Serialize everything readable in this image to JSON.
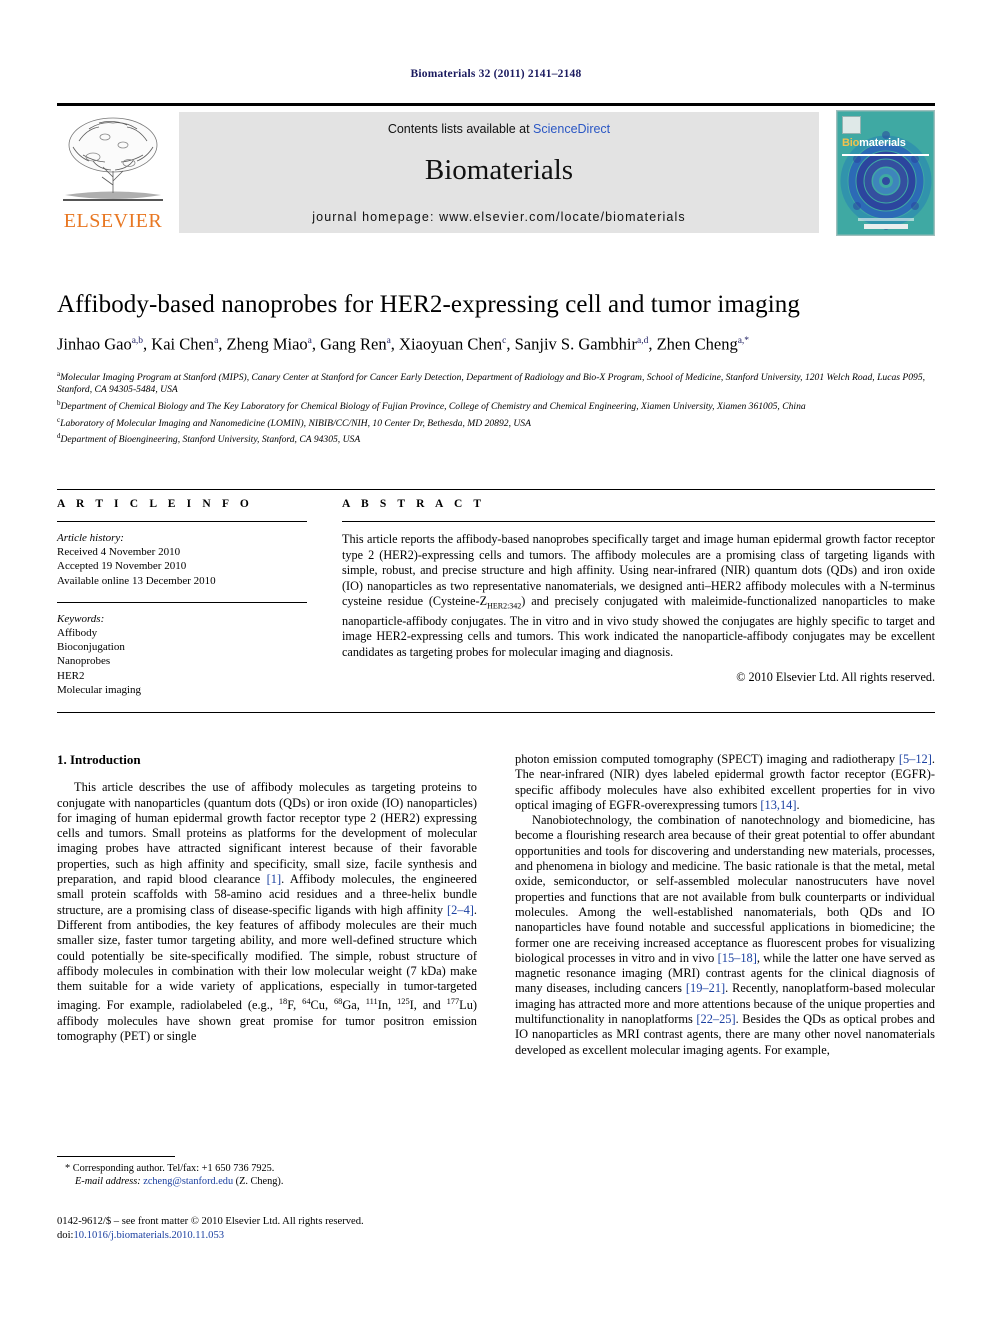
{
  "running_head": "Biomaterials 32 (2011) 2141–2148",
  "masthead": {
    "contents_prefix": "Contents lists available at ",
    "sciencedirect": "ScienceDirect",
    "journal_name": "Biomaterials",
    "homepage": "journal homepage: www.elsevier.com/locate/biomaterials",
    "publisher_wordmark": "ELSEVIER",
    "cover_title_bio": "Bio",
    "cover_title_rest": "materials",
    "colors": {
      "elsevier_orange": "#E87722",
      "link_blue": "#2b57c4",
      "cover_teal": "#3aa9a5",
      "cover_blue": "#2f3f9e"
    }
  },
  "article": {
    "title": "Affibody-based nanoprobes for HER2-expressing cell and tumor imaging",
    "authors": [
      {
        "name": "Jinhao Gao",
        "marks": "a,b"
      },
      {
        "name": "Kai Chen",
        "marks": "a"
      },
      {
        "name": "Zheng Miao",
        "marks": "a"
      },
      {
        "name": "Gang Ren",
        "marks": "a"
      },
      {
        "name": "Xiaoyuan Chen",
        "marks": "c"
      },
      {
        "name": "Sanjiv S. Gambhir",
        "marks": "a,d"
      },
      {
        "name": "Zhen Cheng",
        "marks": "a,*"
      }
    ],
    "affiliations": [
      {
        "mark": "a",
        "text": "Molecular Imaging Program at Stanford (MIPS), Canary Center at Stanford for Cancer Early Detection, Department of Radiology and Bio-X Program, School of Medicine, Stanford University, 1201 Welch Road, Lucas P095, Stanford, CA 94305-5484, USA"
      },
      {
        "mark": "b",
        "text": "Department of Chemical Biology and The Key Laboratory for Chemical Biology of Fujian Province, College of Chemistry and Chemical Engineering, Xiamen University, Xiamen 361005, China"
      },
      {
        "mark": "c",
        "text": "Laboratory of Molecular Imaging and Nanomedicine (LOMIN), NIBIB/CC/NIH, 10 Center Dr, Bethesda, MD 20892, USA"
      },
      {
        "mark": "d",
        "text": "Department of Bioengineering, Stanford University, Stanford, CA 94305, USA"
      }
    ]
  },
  "article_info": {
    "heading": "A R T I C L E   I N F O",
    "history_label": "Article history:",
    "history": [
      "Received 4 November 2010",
      "Accepted 19 November 2010",
      "Available online 13 December 2010"
    ],
    "keywords_label": "Keywords:",
    "keywords": [
      "Affibody",
      "Bioconjugation",
      "Nanoprobes",
      "HER2",
      "Molecular imaging"
    ]
  },
  "abstract": {
    "heading": "A B S T R A C T",
    "part1": "This article reports the affibody-based nanoprobes specifically target and image human epidermal growth factor receptor type 2 (HER2)-expressing cells and tumors. The affibody molecules are a promising class of targeting ligands with simple, robust, and precise structure and high affinity. Using near-infrared (NIR) quantum dots (QDs) and iron oxide (IO) nanoparticles as two representative nanomaterials, we designed anti–HER2 affibody molecules with a N-terminus cysteine residue (Cysteine-Z",
    "subscript": "HER2:342",
    "part2": ") and precisely conjugated with maleimide-functionalized nanoparticles to make nanoparticle-affibody conjugates. The in vitro and in vivo study showed the conjugates are highly specific to target and image HER2-expressing cells and tumors. This work indicated the nanoparticle-affibody conjugates may be excellent candidates as targeting probes for molecular imaging and diagnosis.",
    "copyright": "© 2010 Elsevier Ltd. All rights reserved."
  },
  "body": {
    "section_title": "1.  Introduction",
    "left_p1_a": "This article describes the use of affibody molecules as targeting proteins to conjugate with nanoparticles (quantum dots (QDs) or iron oxide (IO) nanoparticles) for imaging of human epidermal growth factor receptor type 2 (HER2) expressing cells and tumors. Small proteins as platforms for the development of molecular imaging probes have attracted significant interest because of their favorable properties, such as high affinity and specificity, small size, facile synthesis and preparation, and rapid blood clearance ",
    "left_ref1": "[1]",
    "left_p1_b": ". Affibody molecules, the engineered small protein scaffolds with 58-amino acid residues and a three-helix bundle structure, are a promising class of disease-specific ligands with high affinity ",
    "left_ref2": "[2–4]",
    "left_p1_c": ". Different from antibodies, the key features of affibody molecules are their much smaller size, faster tumor targeting ability, and more well-defined structure which could potentially be site-specifically modified. The simple, robust structure of affibody molecules in combination with their low molecular weight (7 kDa) make them suitable for a wide variety of applications, especially in tumor-targeted imaging. For example, radiolabeled (e.g., ",
    "iso_18": "18",
    "iso_18_el": "F, ",
    "iso_64": "64",
    "iso_64_el": "Cu, ",
    "iso_68": "68",
    "iso_68_el": "Ga, ",
    "iso_111": "111",
    "iso_111_el": "In, ",
    "iso_125": "125",
    "iso_125_el": "I, and ",
    "iso_177": "177",
    "iso_177_el": "Lu) affibody molecules have shown great promise for tumor positron emission tomography (PET) or single",
    "right_p1_a": "photon emission computed tomography (SPECT) imaging and radiotherapy ",
    "right_ref1": "[5–12]",
    "right_p1_b": ". The near-infrared (NIR) dyes labeled epidermal growth factor receptor (EGFR)-specific affibody molecules have also exhibited excellent properties for in vivo optical imaging of EGFR-overexpressing tumors ",
    "right_ref2": "[13,14]",
    "right_p1_c": ".",
    "right_p2_a": "Nanobiotechnology, the combination of nanotechnology and biomedicine, has become a flourishing research area because of their great potential to offer abundant opportunities and tools for discovering and understanding new materials, processes, and phenomena in biology and medicine. The basic rationale is that the metal, metal oxide, semiconductor, or self-assembled molecular nanostrucuters have novel properties and functions that are not available from bulk counterparts or individual molecules. Among the well-established nanomaterials, both QDs and IO nanoparticles have found notable and successful applications in biomedicine; the former one are receiving increased acceptance as fluorescent probes for visualizing biological processes in vitro and in vivo ",
    "right_ref3": "[15–18]",
    "right_p2_b": ", while the latter one have served as magnetic resonance imaging (MRI) contrast agents for the clinical diagnosis of many diseases, including cancers ",
    "right_ref4": "[19–21]",
    "right_p2_c": ". Recently, nanoplatform-based molecular imaging has attracted more and more attentions because of the unique properties and multifunctionality in nanoplatforms ",
    "right_ref5": "[22–25]",
    "right_p2_d": ". Besides the QDs as optical probes and IO nanoparticles as MRI contrast agents, there are many other novel nanomaterials developed as excellent molecular imaging agents. For example,"
  },
  "footnotes": {
    "corresponding": "* Corresponding author. Tel/fax: +1 650 736 7925.",
    "email_label": "E-mail address:",
    "email": "zcheng@stanford.edu",
    "email_suffix": "(Z. Cheng)."
  },
  "imprint": {
    "line1": "0142-9612/$ – see front matter © 2010 Elsevier Ltd. All rights reserved.",
    "doi_label": "doi:",
    "doi_value": "10.1016/j.biomaterials.2010.11.053"
  }
}
